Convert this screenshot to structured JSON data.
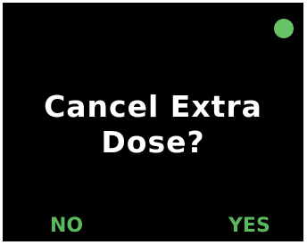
{
  "colors": {
    "background": "#000000",
    "text": "#ffffff",
    "accent": "#5bb85d",
    "status_indicator": "#66c466"
  },
  "status": {
    "icon": "green-status-dot-icon"
  },
  "prompt": {
    "line1": "Cancel Extra",
    "line2": "Dose?"
  },
  "softkeys": {
    "left_label": "NO",
    "right_label": "YES"
  }
}
